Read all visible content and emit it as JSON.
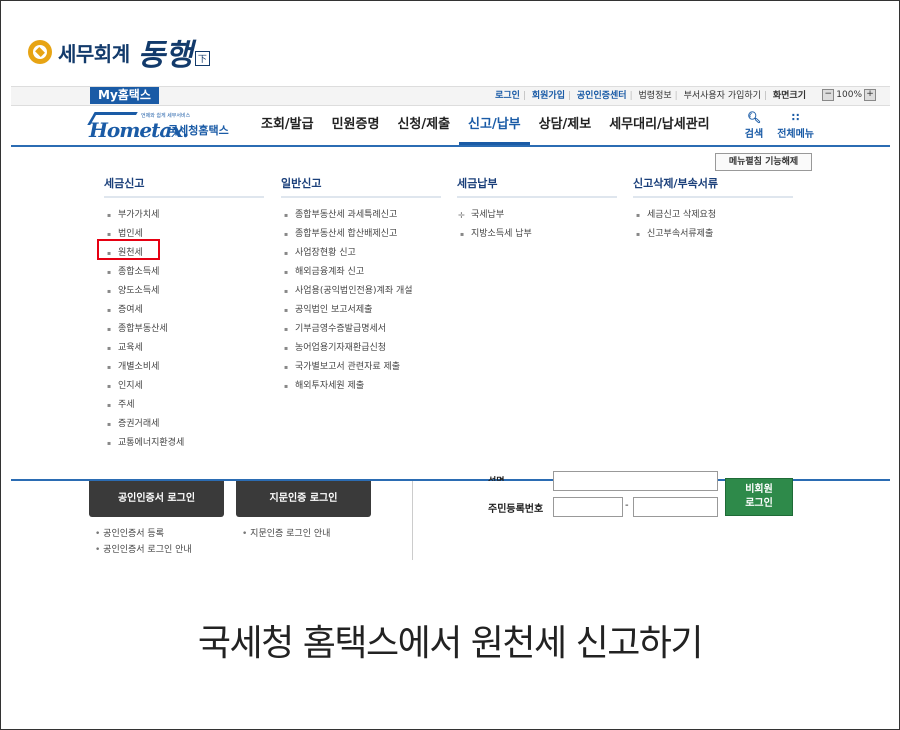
{
  "brand": {
    "name": "세무회계",
    "script": "동행",
    "mark": "下"
  },
  "topbar": {
    "my_tab": "My홈택스",
    "links": [
      "로그인",
      "회원가입",
      "공인인증센터",
      "법령정보",
      "부서사용자 가입하기",
      "화면크기"
    ],
    "zoom_minus": "−",
    "zoom_value": "100%",
    "zoom_plus": "+"
  },
  "nav": {
    "logo_main": "Home",
    "logo_tax": "tax.",
    "logo_sub": "언제와 쉽게 세무서비스",
    "logo_kr": "국세청홈택스",
    "items": [
      "조회/발급",
      "민원증명",
      "신청/제출",
      "신고/납부",
      "상담/제보",
      "세무대리/납세관리"
    ],
    "active_index": 3,
    "search_label": "검색",
    "all_menu_label": "전체메뉴"
  },
  "menu_close": "메뉴펼침 기능해제",
  "mega_menu": {
    "columns": [
      {
        "title": "세금신고",
        "items": [
          "부가가치세",
          "법인세",
          "원천세",
          "종합소득세",
          "양도소득세",
          "증여세",
          "종합부동산세",
          "교육세",
          "개별소비세",
          "인지세",
          "주세",
          "증권거래세",
          "교통에너지환경세"
        ]
      },
      {
        "title": "일반신고",
        "items": [
          "종합부동산세 과세특례신고",
          "종합부동산세 합산배제신고",
          "사업장현황 신고",
          "해외금융계좌 신고",
          "사업용(공익법인전용)계좌 개설",
          "공익법인 보고서제출",
          "기부금영수증발급명세서",
          "농어업용기자재환급신청",
          "국가별보고서 관련자료 제출",
          "해외투자세원 제출"
        ]
      },
      {
        "title": "세금납부",
        "items": [
          "국세납부",
          "지방소득세 납부"
        ]
      },
      {
        "title": "신고삭제/부속서류",
        "items": [
          "세금신고 삭제요청",
          "신고부속서류제출"
        ]
      }
    ],
    "highlighted": "원천세"
  },
  "login": {
    "cert_button": "공인인증서 로그인",
    "finger_button": "지문인증 로그인",
    "cert_links": [
      "공인인증서 등록",
      "공인인증서 로그인 안내"
    ],
    "finger_links": [
      "지문인증 로그인 안내"
    ],
    "name_label": "성명",
    "rrn_label": "주민등록번호",
    "rrn_dash": "-",
    "guest_button_line1": "비회원",
    "guest_button_line2": "로그인"
  },
  "caption": "국세청 홈택스에서 원천세 신고하기"
}
